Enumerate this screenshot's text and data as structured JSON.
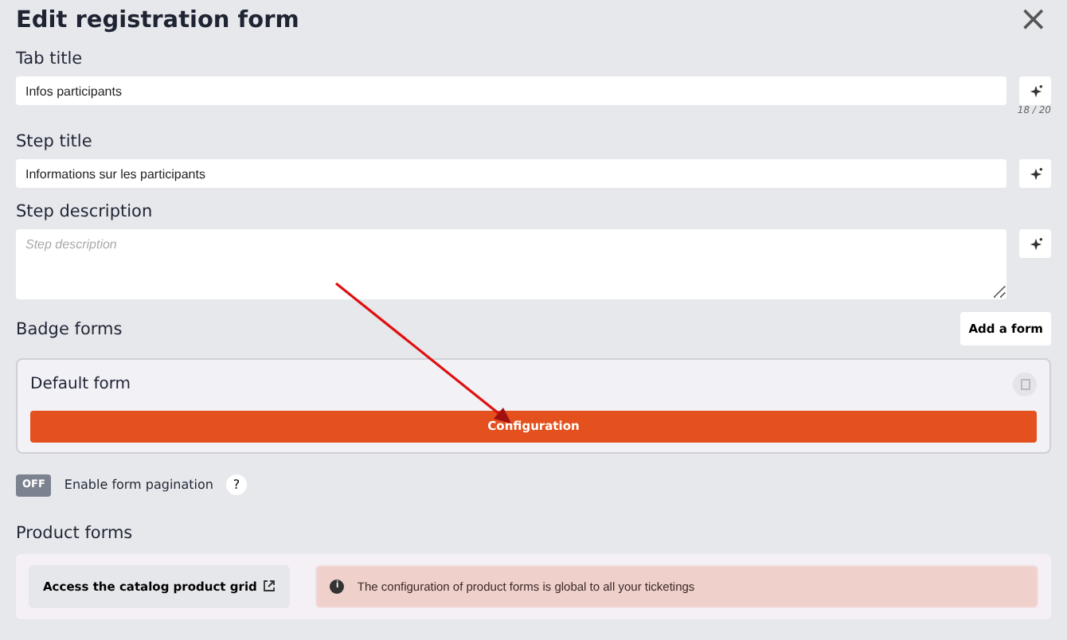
{
  "dialog": {
    "title": "Edit registration form",
    "close": "×"
  },
  "fields": [
    {
      "kind": "input",
      "label": "Tab title",
      "value": "Infos participants",
      "counter": "18 / 20"
    },
    {
      "kind": "input",
      "label": "Step title",
      "value": "Informations sur les participants"
    },
    {
      "kind": "textarea",
      "label": "Step description",
      "placeholder": "Step description"
    }
  ],
  "badge_forms": {
    "title": "Badge forms",
    "add_button": "Add a form",
    "forms": [
      {
        "name": "Default form",
        "button": "Configuration"
      }
    ]
  },
  "pagination": {
    "on": false,
    "switch_text": "OFF",
    "label": "Enable form pagination",
    "help": "?"
  },
  "product_forms": {
    "title": "Product forms",
    "link": "Access the catalog product grid",
    "info_icon": "i",
    "alert": "The configuration of product forms is global to all your ticketings"
  }
}
